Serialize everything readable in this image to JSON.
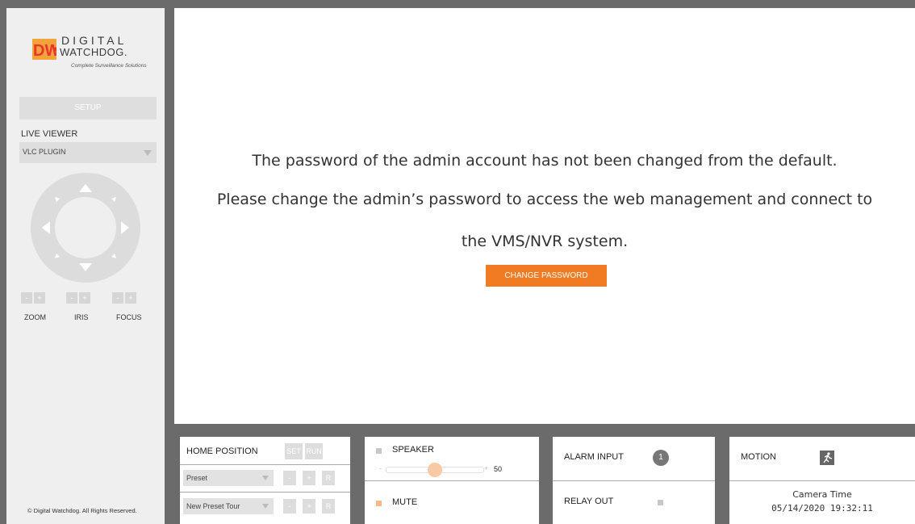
{
  "sidebar": {
    "logo": {
      "digital": "DIGITAL",
      "watchdog": "WATCHDOG.",
      "tagline": "Complete Surveillance Solutions"
    },
    "setup_label": "SETUP",
    "live_viewer_label": "LIVE VIEWER",
    "viewer_select_value": "VLC PLUGIN",
    "controls": {
      "minus": "-",
      "plus": "+",
      "zoom_label": "ZOOM",
      "iris_label": "IRIS",
      "focus_label": "FOCUS"
    },
    "copyright": "© Digital Watchdog. All Rights Reserved."
  },
  "main": {
    "message_line1": "The password of the admin account has not been changed from the default.",
    "message_line2": "Please change the admin’s password to access the web management and connect to",
    "message_line3": "the VMS/NVR system.",
    "change_password_label": "CHANGE PASSWORD"
  },
  "bottom": {
    "home_position_label": "HOME POSITION",
    "set_label": "SET",
    "run_label": "RUN",
    "preset_select": "Preset",
    "preset_tour_select": "New Preset Tour",
    "minus": "-",
    "plus": "+",
    "r_label": "R",
    "speaker_label": "SPEAKER",
    "volume_minus": "-",
    "volume_plus": "+",
    "volume_value": "50",
    "volume_fraction": 0.5,
    "mute_label": "MUTE",
    "alarm_input_label": "ALARM INPUT",
    "alarm_input_badge": "1",
    "relay_out_label": "RELAY OUT",
    "motion_label": "MOTION",
    "camera_time_label": "Camera Time",
    "camera_time_value": "05/14/2020 19:32:11"
  },
  "colors": {
    "accent": "#f07b22",
    "frame": "#6b6b6b",
    "sidebar_bg": "#efefef",
    "dw_red": "#e8352e"
  },
  "icons": [
    "dw-logo-icon",
    "ptz-up-icon",
    "ptz-down-icon",
    "ptz-left-icon",
    "ptz-right-icon",
    "dropdown-arrow-icon",
    "motion-runner-icon",
    "checkbox-icon"
  ]
}
